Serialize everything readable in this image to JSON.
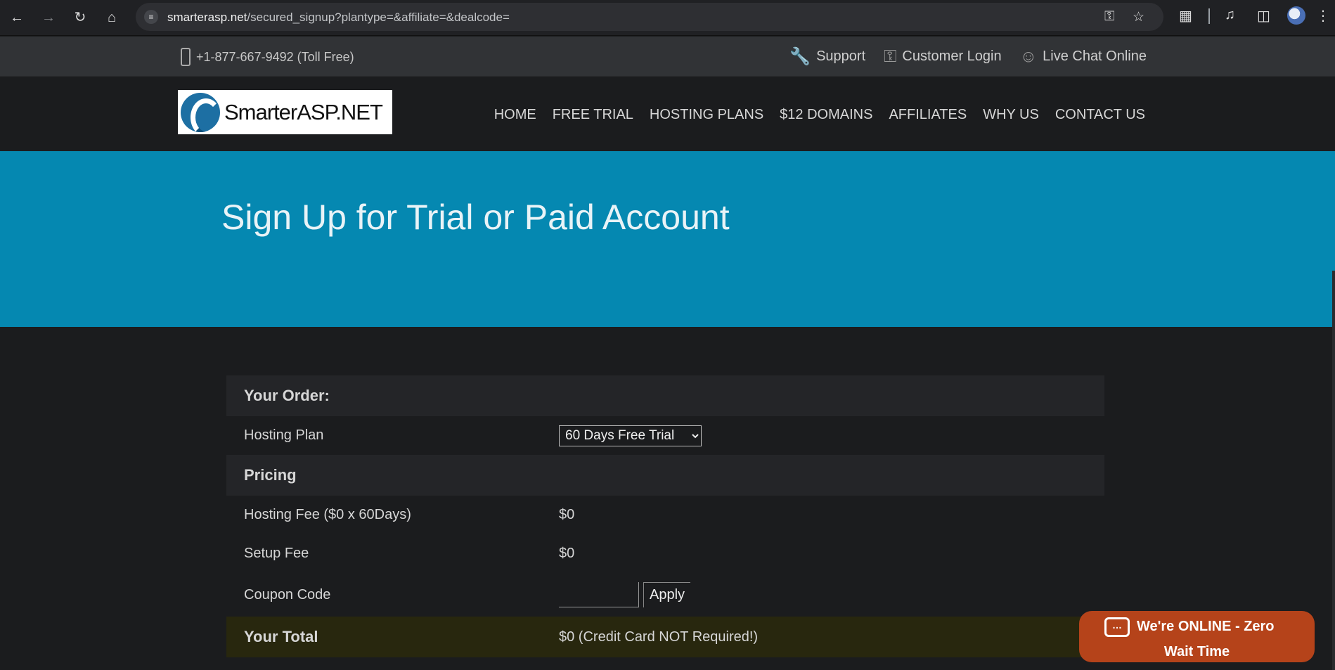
{
  "browser": {
    "url_host": "smarterasp.net",
    "url_path": "/secured_signup?plantype=&affiliate=&dealcode="
  },
  "topbar": {
    "phone": "+1-877-667-9492 (Toll Free)",
    "links": [
      {
        "label": "Support",
        "icon": "wrench-icon"
      },
      {
        "label": "Customer Login",
        "icon": "key-icon"
      },
      {
        "label": "Live Chat Online",
        "icon": "chat-agent-icon"
      }
    ]
  },
  "header": {
    "logo_text": "SmarterASP.NET",
    "nav": [
      "HOME",
      "FREE TRIAL",
      "HOSTING PLANS",
      "$12 DOMAINS",
      "AFFILIATES",
      "WHY US",
      "CONTACT US"
    ]
  },
  "hero": {
    "title": "Sign Up for Trial or Paid Account"
  },
  "order": {
    "heading": "Your Order:",
    "hosting_plan_label": "Hosting Plan",
    "hosting_plan_value": "60 Days Free Trial",
    "pricing_heading": "Pricing",
    "hosting_fee_label": "Hosting Fee ($0 x 60Days)",
    "hosting_fee_value": "$0",
    "setup_fee_label": "Setup Fee",
    "setup_fee_value": "$0",
    "coupon_label": "Coupon Code",
    "coupon_value": "",
    "apply_label": "Apply",
    "total_label": "Your Total",
    "total_value": "$0 (Credit Card NOT Required!)"
  },
  "chat_widget": {
    "line1": "We're ONLINE - Zero",
    "line2": "Wait Time"
  },
  "colors": {
    "hero_bg": "#0588b1",
    "chat_bg": "#b5431a",
    "page_bg": "#1b1c1e"
  }
}
